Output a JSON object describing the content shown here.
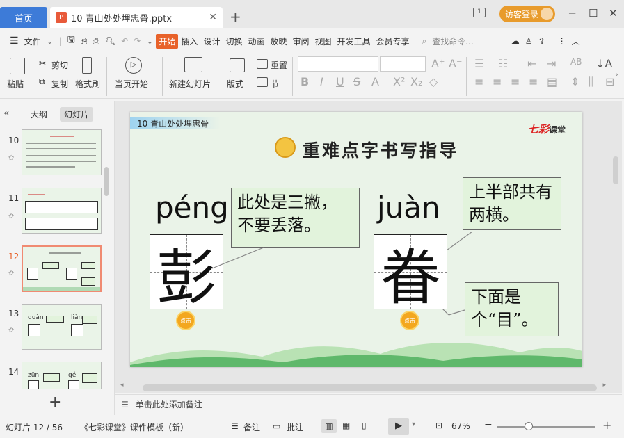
{
  "tabs": {
    "home": "首页",
    "file_name": "10 青山处处埋忠骨.pptx"
  },
  "login": {
    "label": "访客登录"
  },
  "menu": {
    "file": "文件",
    "items": [
      "开始",
      "插入",
      "设计",
      "切换",
      "动画",
      "放映",
      "审阅",
      "视图",
      "开发工具",
      "会员专享"
    ],
    "active": "开始",
    "search_placeholder": "查找命令..."
  },
  "ribbon": {
    "paste": "粘贴",
    "cut": "剪切",
    "copy": "复制",
    "format_painter": "格式刷",
    "start_from_current": "当页开始",
    "new_slide": "新建幻灯片",
    "layout": "版式",
    "reset": "重置",
    "section": "节"
  },
  "left_panel": {
    "tab_outline": "大纲",
    "tab_slides": "幻灯片",
    "slide_numbers": [
      "10",
      "11",
      "12",
      "13",
      "14"
    ],
    "active_slide": "12",
    "thumb13_pinyin": [
      "duàn",
      "liàn"
    ],
    "thumb14_pinyin": [
      "zūn",
      "gé"
    ]
  },
  "slide": {
    "lesson_title": "10 青山处处埋忠骨",
    "brand": "七彩",
    "brand_suffix": "课堂",
    "title": "重难点字书写指导",
    "left": {
      "pinyin": "péng",
      "char": "彭",
      "note": "此处是三撇，不要丢落。"
    },
    "right": {
      "pinyin": "juàn",
      "char": "眷",
      "note_top": "上半部共有两横。",
      "note_bottom": "下面是个“目”。"
    },
    "click_label": "点击"
  },
  "notes": {
    "placeholder": "单击此处添加备注"
  },
  "status": {
    "slide_counter": "幻灯片 12 / 56",
    "template": "《七彩课堂》课件模板（新）",
    "remarks": "备注",
    "comments": "批注",
    "zoom": "67%"
  },
  "colors": {
    "accent": "#e8622a",
    "home_tab": "#3d7bd8",
    "login": "#e89b2c",
    "note_bg": "#e2f3dc"
  }
}
